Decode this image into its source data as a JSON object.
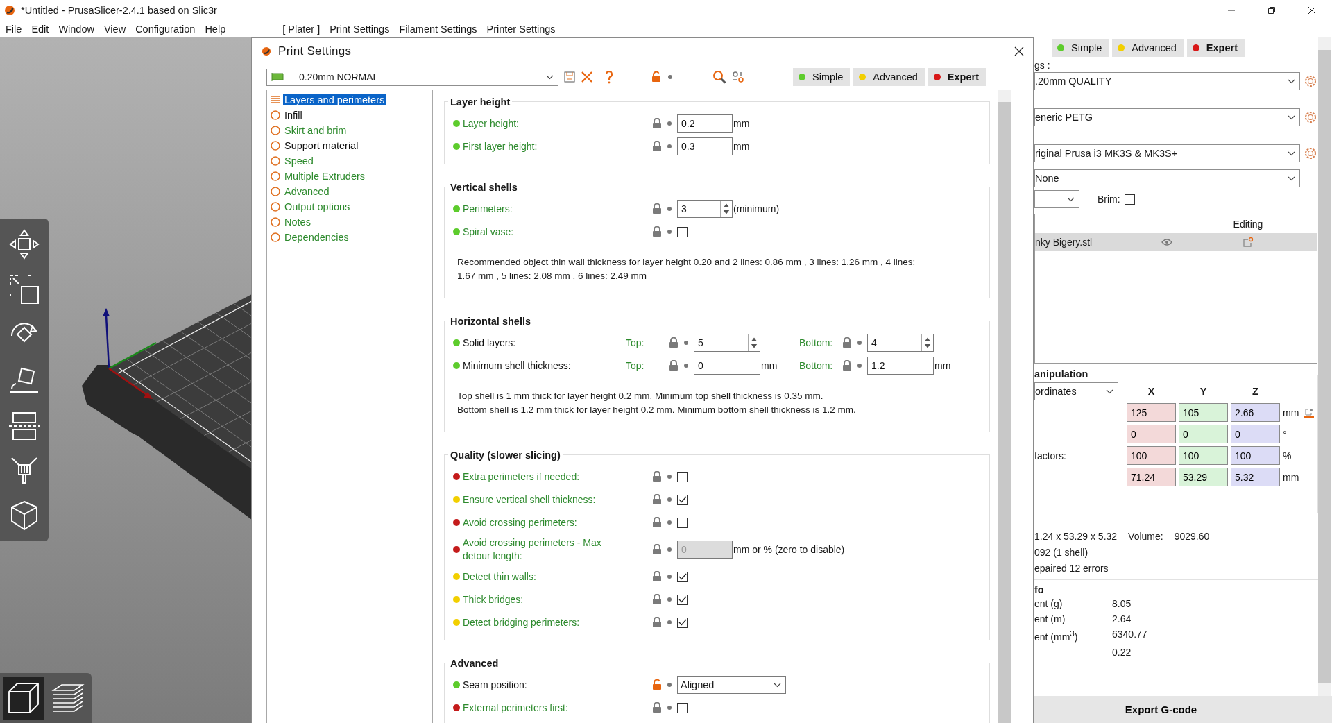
{
  "window": {
    "title": "*Untitled - PrusaSlicer-2.4.1 based on Slic3r"
  },
  "menu": [
    "File",
    "Edit",
    "Window",
    "View",
    "Configuration",
    "Help"
  ],
  "tabs": [
    "[ Plater ]",
    "Print Settings",
    "Filament Settings",
    "Printer Settings"
  ],
  "viewport": {
    "view_toggle": [
      {
        "kind": "model",
        "selected": true
      },
      {
        "kind": "preview",
        "selected": false
      }
    ]
  },
  "dialog": {
    "title": "Print Settings",
    "preset": "0.20mm NORMAL",
    "modes": [
      {
        "label": "Simple",
        "color": "#5dcc2c",
        "selected": false
      },
      {
        "label": "Advanced",
        "color": "#f2cf00",
        "selected": false
      },
      {
        "label": "Expert",
        "color": "#d81818",
        "selected": true
      }
    ],
    "tree": [
      {
        "label": "Layers and perimeters",
        "selected": true,
        "modified": true
      },
      {
        "label": "Infill",
        "selected": false,
        "modified": true
      },
      {
        "label": "Skirt and brim",
        "selected": false,
        "modified": false
      },
      {
        "label": "Support material",
        "selected": false,
        "modified": true
      },
      {
        "label": "Speed",
        "selected": false,
        "modified": false
      },
      {
        "label": "Multiple Extruders",
        "selected": false,
        "modified": false
      },
      {
        "label": "Advanced",
        "selected": false,
        "modified": false
      },
      {
        "label": "Output options",
        "selected": false,
        "modified": false
      },
      {
        "label": "Notes",
        "selected": false,
        "modified": false
      },
      {
        "label": "Dependencies",
        "selected": false,
        "modified": false
      }
    ],
    "sections": [
      {
        "title": "Layer height",
        "rows": [
          {
            "label": "Layer height:",
            "color": "#5dcc2c",
            "modified": false,
            "fields": [
              {
                "kind": "input",
                "locked": true,
                "value": "0.2",
                "unit": "mm",
                "disabled": false
              }
            ]
          },
          {
            "label": "First layer height:",
            "color": "#5dcc2c",
            "modified": false,
            "fields": [
              {
                "kind": "input",
                "locked": true,
                "value": "0.3",
                "unit": "mm",
                "disabled": false
              }
            ]
          }
        ]
      },
      {
        "title": "Vertical shells",
        "rows": [
          {
            "label": "Perimeters:",
            "color": "#5dcc2c",
            "modified": false,
            "fields": [
              {
                "kind": "spin",
                "locked": true,
                "value": "3",
                "unit": "(minimum)"
              }
            ]
          },
          {
            "label": "Spiral vase:",
            "color": "#5dcc2c",
            "modified": false,
            "fields": [
              {
                "kind": "checkbox",
                "locked": true,
                "checked": false
              }
            ]
          }
        ],
        "notes": [
          "Recommended object thin wall thickness for layer height 0.20 and 2 lines: 0.86 mm , 3 lines: 1.26 mm , 4 lines: 1.67 mm , 5 lines: 2.08 mm , 6 lines: 2.49 mm"
        ]
      },
      {
        "title": "Horizontal shells",
        "rows": [
          {
            "label": "Solid layers:",
            "color": "#5dcc2c",
            "modified": true,
            "fields": [
              {
                "sublabel": "Top:",
                "kind": "spin",
                "locked": true,
                "value": "5"
              },
              {
                "sublabel": "Bottom:",
                "kind": "spin",
                "locked": true,
                "value": "4"
              }
            ]
          },
          {
            "label": "Minimum shell thickness:",
            "color": "#5dcc2c",
            "modified": true,
            "fields": [
              {
                "sublabel": "Top:",
                "kind": "input",
                "locked": true,
                "value": "0",
                "unit": "mm",
                "disabled": false
              },
              {
                "sublabel": "Bottom:",
                "kind": "input",
                "locked": true,
                "value": "1.2",
                "unit": "mm",
                "disabled": false
              }
            ]
          }
        ],
        "notes": [
          "Top shell is 1 mm thick for layer height 0.2 mm. Minimum top shell thickness is 0.35 mm.",
          "Bottom shell is 1.2 mm thick for layer height 0.2 mm. Minimum bottom shell thickness is 1.2 mm."
        ]
      },
      {
        "title": "Quality (slower slicing)",
        "rows": [
          {
            "label": "Extra perimeters if needed:",
            "color": "#c41b1b",
            "modified": false,
            "fields": [
              {
                "kind": "checkbox",
                "locked": true,
                "checked": false
              }
            ]
          },
          {
            "label": "Ensure vertical shell thickness:",
            "color": "#f2cf00",
            "modified": false,
            "fields": [
              {
                "kind": "checkbox",
                "locked": true,
                "checked": true
              }
            ]
          },
          {
            "label": "Avoid crossing perimeters:",
            "color": "#c41b1b",
            "modified": false,
            "fields": [
              {
                "kind": "checkbox",
                "locked": true,
                "checked": false
              }
            ]
          },
          {
            "label": "Avoid crossing perimeters - Max detour length:",
            "color": "#c41b1b",
            "modified": false,
            "fields": [
              {
                "kind": "input",
                "locked": true,
                "value": "0",
                "unit": "mm or % (zero to disable)",
                "disabled": true
              }
            ]
          },
          {
            "label": "Detect thin walls:",
            "color": "#f2cf00",
            "modified": false,
            "fields": [
              {
                "kind": "checkbox",
                "locked": true,
                "checked": true
              }
            ]
          },
          {
            "label": "Thick bridges:",
            "color": "#f2cf00",
            "modified": false,
            "fields": [
              {
                "kind": "checkbox",
                "locked": true,
                "checked": true
              }
            ]
          },
          {
            "label": "Detect bridging perimeters:",
            "color": "#f2cf00",
            "modified": false,
            "fields": [
              {
                "kind": "checkbox",
                "locked": true,
                "checked": true
              }
            ]
          }
        ]
      },
      {
        "title": "Advanced",
        "rows": [
          {
            "label": "Seam position:",
            "color": "#5dcc2c",
            "modified": true,
            "fields": [
              {
                "kind": "select",
                "locked": false,
                "value": "Aligned"
              }
            ]
          },
          {
            "label": "External perimeters first:",
            "color": "#c41b1b",
            "modified": false,
            "fields": [
              {
                "kind": "checkbox",
                "locked": true,
                "checked": false
              }
            ]
          }
        ]
      }
    ]
  },
  "right_panel": {
    "modes": [
      {
        "label": "Simple",
        "color": "#5dcc2c",
        "selected": false
      },
      {
        "label": "Advanced",
        "color": "#f2cf00",
        "selected": false
      },
      {
        "label": "Expert",
        "color": "#d81818",
        "selected": true
      }
    ],
    "presets_label": "gs :",
    "presets": [
      {
        "value": ".20mm QUALITY",
        "gear": true
      },
      {
        "value": "eneric PETG",
        "gear": true
      },
      {
        "value": "riginal Prusa i3 MK3S & MK3S+",
        "gear": true
      },
      {
        "value": "None",
        "gear": false
      }
    ],
    "brim": {
      "label": "Brim:",
      "checked": false
    },
    "object_list": {
      "header": "Editing",
      "rows": [
        {
          "name": "nky Bigery.stl",
          "selected": true
        }
      ]
    },
    "manipulation": {
      "title": "anipulation",
      "coordinates": "ordinates",
      "axes": [
        {
          "label": "X",
          "color": "#f3d9d9"
        },
        {
          "label": "Y",
          "color": "#d9f3d9"
        },
        {
          "label": "Z",
          "color": "#dcdcf6"
        }
      ],
      "rows": [
        {
          "values": [
            "125",
            "105",
            "2.66"
          ],
          "unit": "mm"
        },
        {
          "values": [
            "0",
            "0",
            "0"
          ],
          "unit": "°"
        },
        {
          "label": "factors:",
          "values": [
            "100",
            "100",
            "100"
          ],
          "unit": "%"
        },
        {
          "values": [
            "71.24",
            "53.29",
            "5.32"
          ],
          "unit": "mm"
        }
      ]
    },
    "info": {
      "size": "1.24 x 53.29 x 5.32",
      "volume_label": "Volume:",
      "volume": "9029.60",
      "facets": "092 (1 shell)",
      "errors": "epaired 12 errors"
    },
    "sliced_info": {
      "title": "fo",
      "rows": [
        {
          "label": "ent (g)",
          "value": "8.05"
        },
        {
          "label": "ent (m)",
          "value": "2.64"
        },
        {
          "label": "ent (mm$^{3}$)",
          "value": "6340.77"
        },
        {
          "value": "0.22"
        }
      ]
    },
    "export_button": "Export G-code"
  }
}
